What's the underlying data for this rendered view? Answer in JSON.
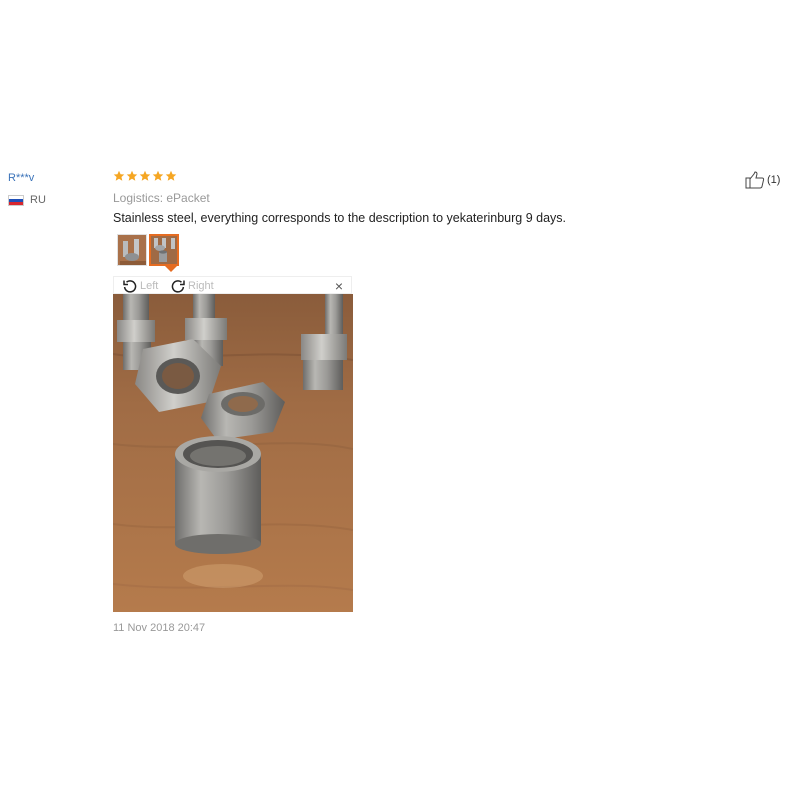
{
  "review": {
    "user": {
      "name": "R***v",
      "country": "RU",
      "flag_colors": [
        "#ffffff",
        "#1f4fb8",
        "#d8262e"
      ]
    },
    "rating": {
      "value": 5,
      "max": 5,
      "star_color": "#f5a623"
    },
    "logistics": "Logistics: ePacket",
    "feedback_text": "Stainless steel, everything corresponds to the description to yekaterinburg 9 days.",
    "thumbnails": [
      {
        "icon": "photo-thumbnail-1",
        "active": false
      },
      {
        "icon": "photo-thumbnail-2",
        "active": true
      }
    ],
    "viewer": {
      "rotate_left_label": "Left",
      "rotate_right_label": "Right",
      "close_label": "×"
    },
    "date": "11 Nov 2018 20:47",
    "helpful": {
      "icon": "thumbs-up-icon",
      "count": "(1)"
    },
    "accent_color": "#e56c22"
  }
}
